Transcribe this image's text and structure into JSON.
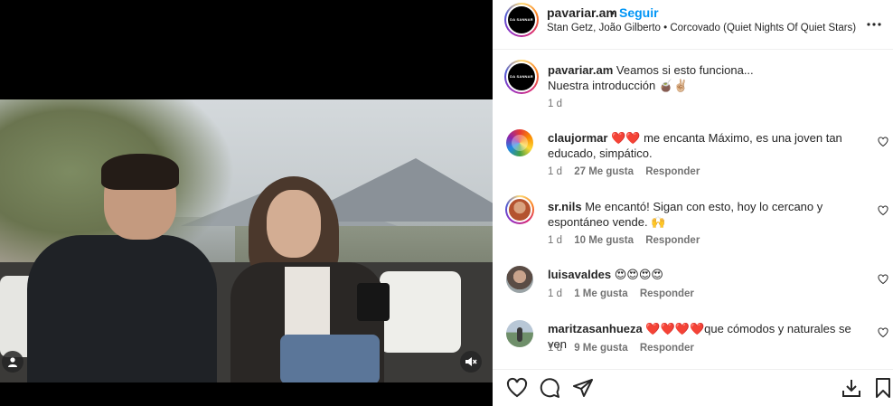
{
  "post": {
    "username": "pavariar.am",
    "avatar_text": "DA SANNAR",
    "dot": "•",
    "follow_label": "Seguir",
    "audio": "Stan Getz, João Gilberto • Corcovado (Quiet Nights Of Quiet Stars) (fe...",
    "more_icon": "more-horizontal-icon"
  },
  "caption": {
    "username": "pavariar.am",
    "line1": "Veamos si esto funciona...",
    "line2": "Nuestra introducción 🧉✌🏼",
    "time": "1 d"
  },
  "comments": [
    {
      "username": "claujormar",
      "text": "❤️❤️ me encanta Máximo, es una joven tan educado, simpático.",
      "time": "1 d",
      "likes": "27 Me gusta",
      "reply": "Responder"
    },
    {
      "username": "sr.nils",
      "text": "Me encantó! Sigan con esto, hoy lo cercano y espontáneo vende. 🙌",
      "time": "1 d",
      "likes": "10 Me gusta",
      "reply": "Responder"
    },
    {
      "username": "luisavaldes",
      "text": "😍😍😍😍",
      "time": "1 d",
      "likes": "1 Me gusta",
      "reply": "Responder"
    },
    {
      "username": "maritzasanhueza",
      "text": "❤️❤️❤️❤️que cómodos y naturales se ven",
      "time": "1 d",
      "likes": "9 Me gusta",
      "reply": "Responder"
    }
  ],
  "actions": {
    "like_icon": "heart-icon",
    "comment_icon": "comment-icon",
    "share_icon": "send-icon",
    "download_icon": "download-icon",
    "save_icon": "bookmark-icon"
  },
  "colors": {
    "link_blue": "#0095f6",
    "meta_gray": "#737373",
    "text": "#262626"
  }
}
